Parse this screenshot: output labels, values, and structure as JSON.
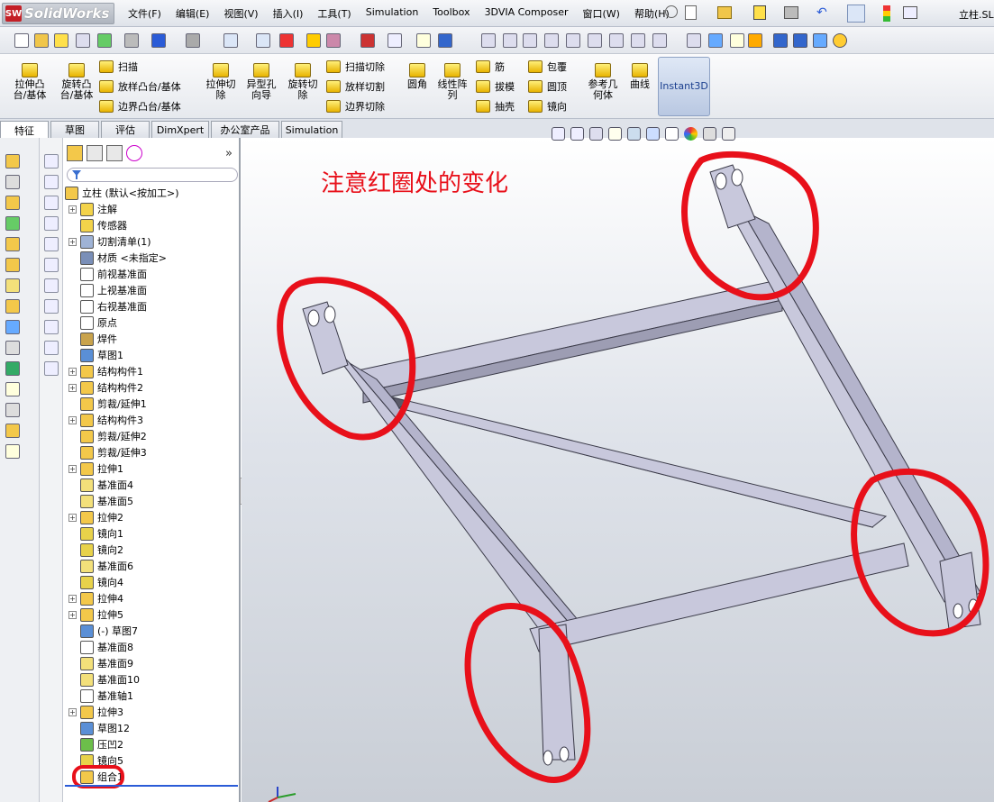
{
  "app": {
    "logo": "SolidWorks",
    "doc_title": "立柱.SL"
  },
  "menu": [
    "文件(F)",
    "编辑(E)",
    "视图(V)",
    "插入(I)",
    "工具(T)",
    "Simulation",
    "Toolbox",
    "3DVIA Composer",
    "窗口(W)",
    "帮助(H)"
  ],
  "command_manager": {
    "big_buttons": [
      {
        "label": "拉伸凸\n台/基体"
      },
      {
        "label": "旋转凸\n台/基体"
      },
      {
        "label": "拉伸切\n除"
      },
      {
        "label": "异型孔\n向导"
      },
      {
        "label": "旋转切\n除"
      },
      {
        "label": "圆角"
      },
      {
        "label": "线性阵\n列"
      },
      {
        "label": "参考几\n何体"
      },
      {
        "label": "曲线"
      },
      {
        "label": "Instant3D"
      }
    ],
    "small_col1": [
      "扫描",
      "放样凸台/基体",
      "边界凸台/基体"
    ],
    "small_col2": [
      "扫描切除",
      "放样切割",
      "边界切除"
    ],
    "small_col3": [
      "筋",
      "拔模",
      "抽壳"
    ],
    "small_col4": [
      "包覆",
      "圆顶",
      "镜向"
    ]
  },
  "tabs": [
    "特征",
    "草图",
    "评估",
    "DimXpert",
    "办公室产品",
    "Simulation"
  ],
  "tree": {
    "root": "立柱  (默认<按加工>)",
    "items": [
      {
        "label": "注解",
        "pm": "+",
        "color": "#f3d34a"
      },
      {
        "label": "传感器",
        "pm": "",
        "color": "#f3d34a"
      },
      {
        "label": "切割清单(1)",
        "pm": "+",
        "color": "#9fb3d6"
      },
      {
        "label": "材质 <未指定>",
        "pm": "",
        "color": "#7a8fb8"
      },
      {
        "label": "前视基准面",
        "pm": "",
        "color": "#ffffff"
      },
      {
        "label": "上视基准面",
        "pm": "",
        "color": "#ffffff"
      },
      {
        "label": "右视基准面",
        "pm": "",
        "color": "#ffffff"
      },
      {
        "label": "原点",
        "pm": "",
        "color": "#ffffff"
      },
      {
        "label": "焊件",
        "pm": "",
        "color": "#c9a34c"
      },
      {
        "label": "草图1",
        "pm": "",
        "color": "#5a8fd6"
      },
      {
        "label": "结构构件1",
        "pm": "+",
        "color": "#f3c84a"
      },
      {
        "label": "结构构件2",
        "pm": "+",
        "color": "#f3c84a"
      },
      {
        "label": "剪裁/延伸1",
        "pm": "",
        "color": "#f3c84a"
      },
      {
        "label": "结构构件3",
        "pm": "+",
        "color": "#f3c84a"
      },
      {
        "label": "剪裁/延伸2",
        "pm": "",
        "color": "#f3c84a"
      },
      {
        "label": "剪裁/延伸3",
        "pm": "",
        "color": "#f3c84a"
      },
      {
        "label": "拉伸1",
        "pm": "+",
        "color": "#f3c84a"
      },
      {
        "label": "基准面4",
        "pm": "",
        "color": "#f3e07a"
      },
      {
        "label": "基准面5",
        "pm": "",
        "color": "#f3e07a"
      },
      {
        "label": "拉伸2",
        "pm": "+",
        "color": "#f3c84a"
      },
      {
        "label": "镜向1",
        "pm": "",
        "color": "#e8d24a"
      },
      {
        "label": "镜向2",
        "pm": "",
        "color": "#e8d24a"
      },
      {
        "label": "基准面6",
        "pm": "",
        "color": "#f3e07a"
      },
      {
        "label": "镜向4",
        "pm": "",
        "color": "#e8d24a"
      },
      {
        "label": "拉伸4",
        "pm": "+",
        "color": "#f3c84a"
      },
      {
        "label": "拉伸5",
        "pm": "+",
        "color": "#f3c84a"
      },
      {
        "label": "(-) 草图7",
        "pm": "",
        "color": "#5a8fd6"
      },
      {
        "label": "基准面8",
        "pm": "",
        "color": "#ffffff"
      },
      {
        "label": "基准面9",
        "pm": "",
        "color": "#f3e07a"
      },
      {
        "label": "基准面10",
        "pm": "",
        "color": "#f3e07a"
      },
      {
        "label": "基准轴1",
        "pm": "",
        "color": "#ffffff"
      },
      {
        "label": "拉伸3",
        "pm": "+",
        "color": "#f3c84a"
      },
      {
        "label": "草图12",
        "pm": "",
        "color": "#5a8fd6"
      },
      {
        "label": "压凹2",
        "pm": "",
        "color": "#6cbf4a"
      },
      {
        "label": "镜向5",
        "pm": "",
        "color": "#e8d24a"
      },
      {
        "label": "组合1",
        "pm": "",
        "color": "#f3c84a"
      }
    ]
  },
  "annotation": "注意红圈处的变化",
  "colors": {
    "accent_red": "#e8101a",
    "part_fill": "#c8c8dc",
    "part_stroke": "#3a3a48"
  }
}
